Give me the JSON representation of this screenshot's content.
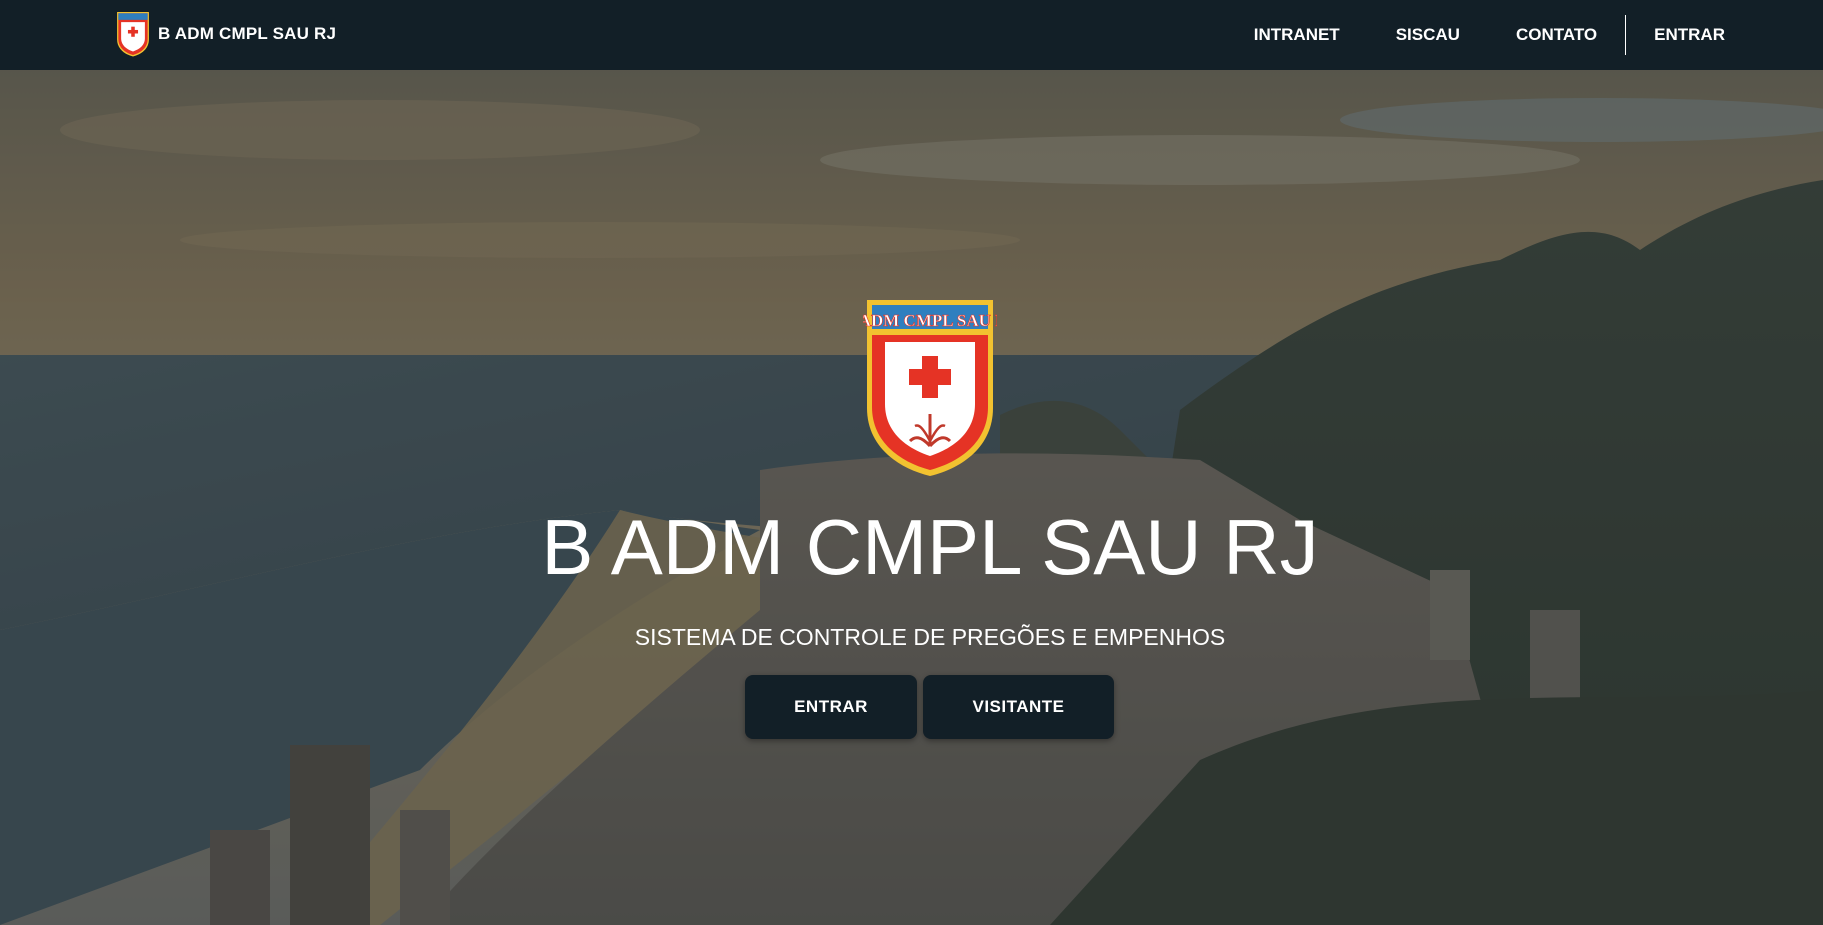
{
  "navbar": {
    "brand_text": "B ADM CMPL SAU RJ",
    "links": [
      {
        "label": "INTRANET"
      },
      {
        "label": "SISCAU"
      },
      {
        "label": "CONTATO"
      },
      {
        "label": "ENTRAR"
      }
    ],
    "background": "#121f27"
  },
  "hero": {
    "emblem_banner": "B ADM CMPL SAU RJ",
    "title": "B ADM CMPL SAU RJ",
    "subtitle": "SISTEMA DE CONTROLE DE PREGÕES E EMPENHOS",
    "buttons": [
      {
        "label": "ENTRAR"
      },
      {
        "label": "VISITANTE"
      }
    ]
  },
  "colors": {
    "shield_red": "#e53325",
    "shield_gold": "#f2c230",
    "shield_blue": "#2f7fbf",
    "button_bg": "#121f27"
  }
}
